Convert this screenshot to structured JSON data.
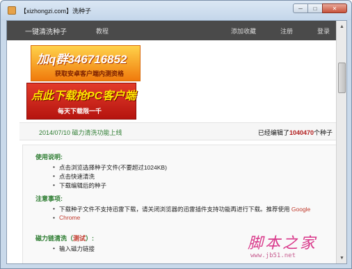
{
  "window": {
    "title": "【xizhongzi.com】洗种子",
    "minimize_glyph": "─",
    "maximize_glyph": "□",
    "close_glyph": "✕"
  },
  "nav": {
    "brand": "一键清洗种子",
    "tutorial": "教程",
    "add_favorite": "添加收藏",
    "register": "注册",
    "login": "登录"
  },
  "banners": {
    "banner1_main": "加q群346716852",
    "banner1_sub": "获取安卓客户端内测资格",
    "banner2_main": "点此下载抢PC客户端",
    "banner2_sub": "每天下载限一千"
  },
  "info": {
    "date_text": "2014/07/10 磁力清洗功能上线",
    "count_prefix": "已经编辑了",
    "count_value": "1040470",
    "count_suffix": "个种子"
  },
  "usage": {
    "title": "使用说明:",
    "items": [
      "点击浏览选择种子文件(不要超过1024KB)",
      "点击快速清洗",
      "下载编辑后的种子"
    ]
  },
  "notes": {
    "title": "注意事项:",
    "line1": "下载种子文件不支持迅雷下载，请关闭浏览器的迅雷插件支持功能再进行下载。推荐使用 ",
    "link_google": "Google",
    "link_chrome": "Chrome"
  },
  "magnet": {
    "title_prefix": "磁力链清洗（",
    "title_test": "测试",
    "title_suffix": "）:",
    "items": [
      "输入磁力链接"
    ]
  },
  "watermark": {
    "cn": "脚本之家",
    "url": "www.jb51.net"
  },
  "colors": {
    "nav_bg": "#4a4a4a",
    "section_green": "#2e7d32",
    "count_red": "#b21f1f",
    "link_red": "#c0392b",
    "watermark_pink": "#d9388a"
  },
  "icons": {
    "app": "torrent-app-icon",
    "scroll_up": "chevron-up-icon",
    "scroll_down": "chevron-down-icon"
  }
}
